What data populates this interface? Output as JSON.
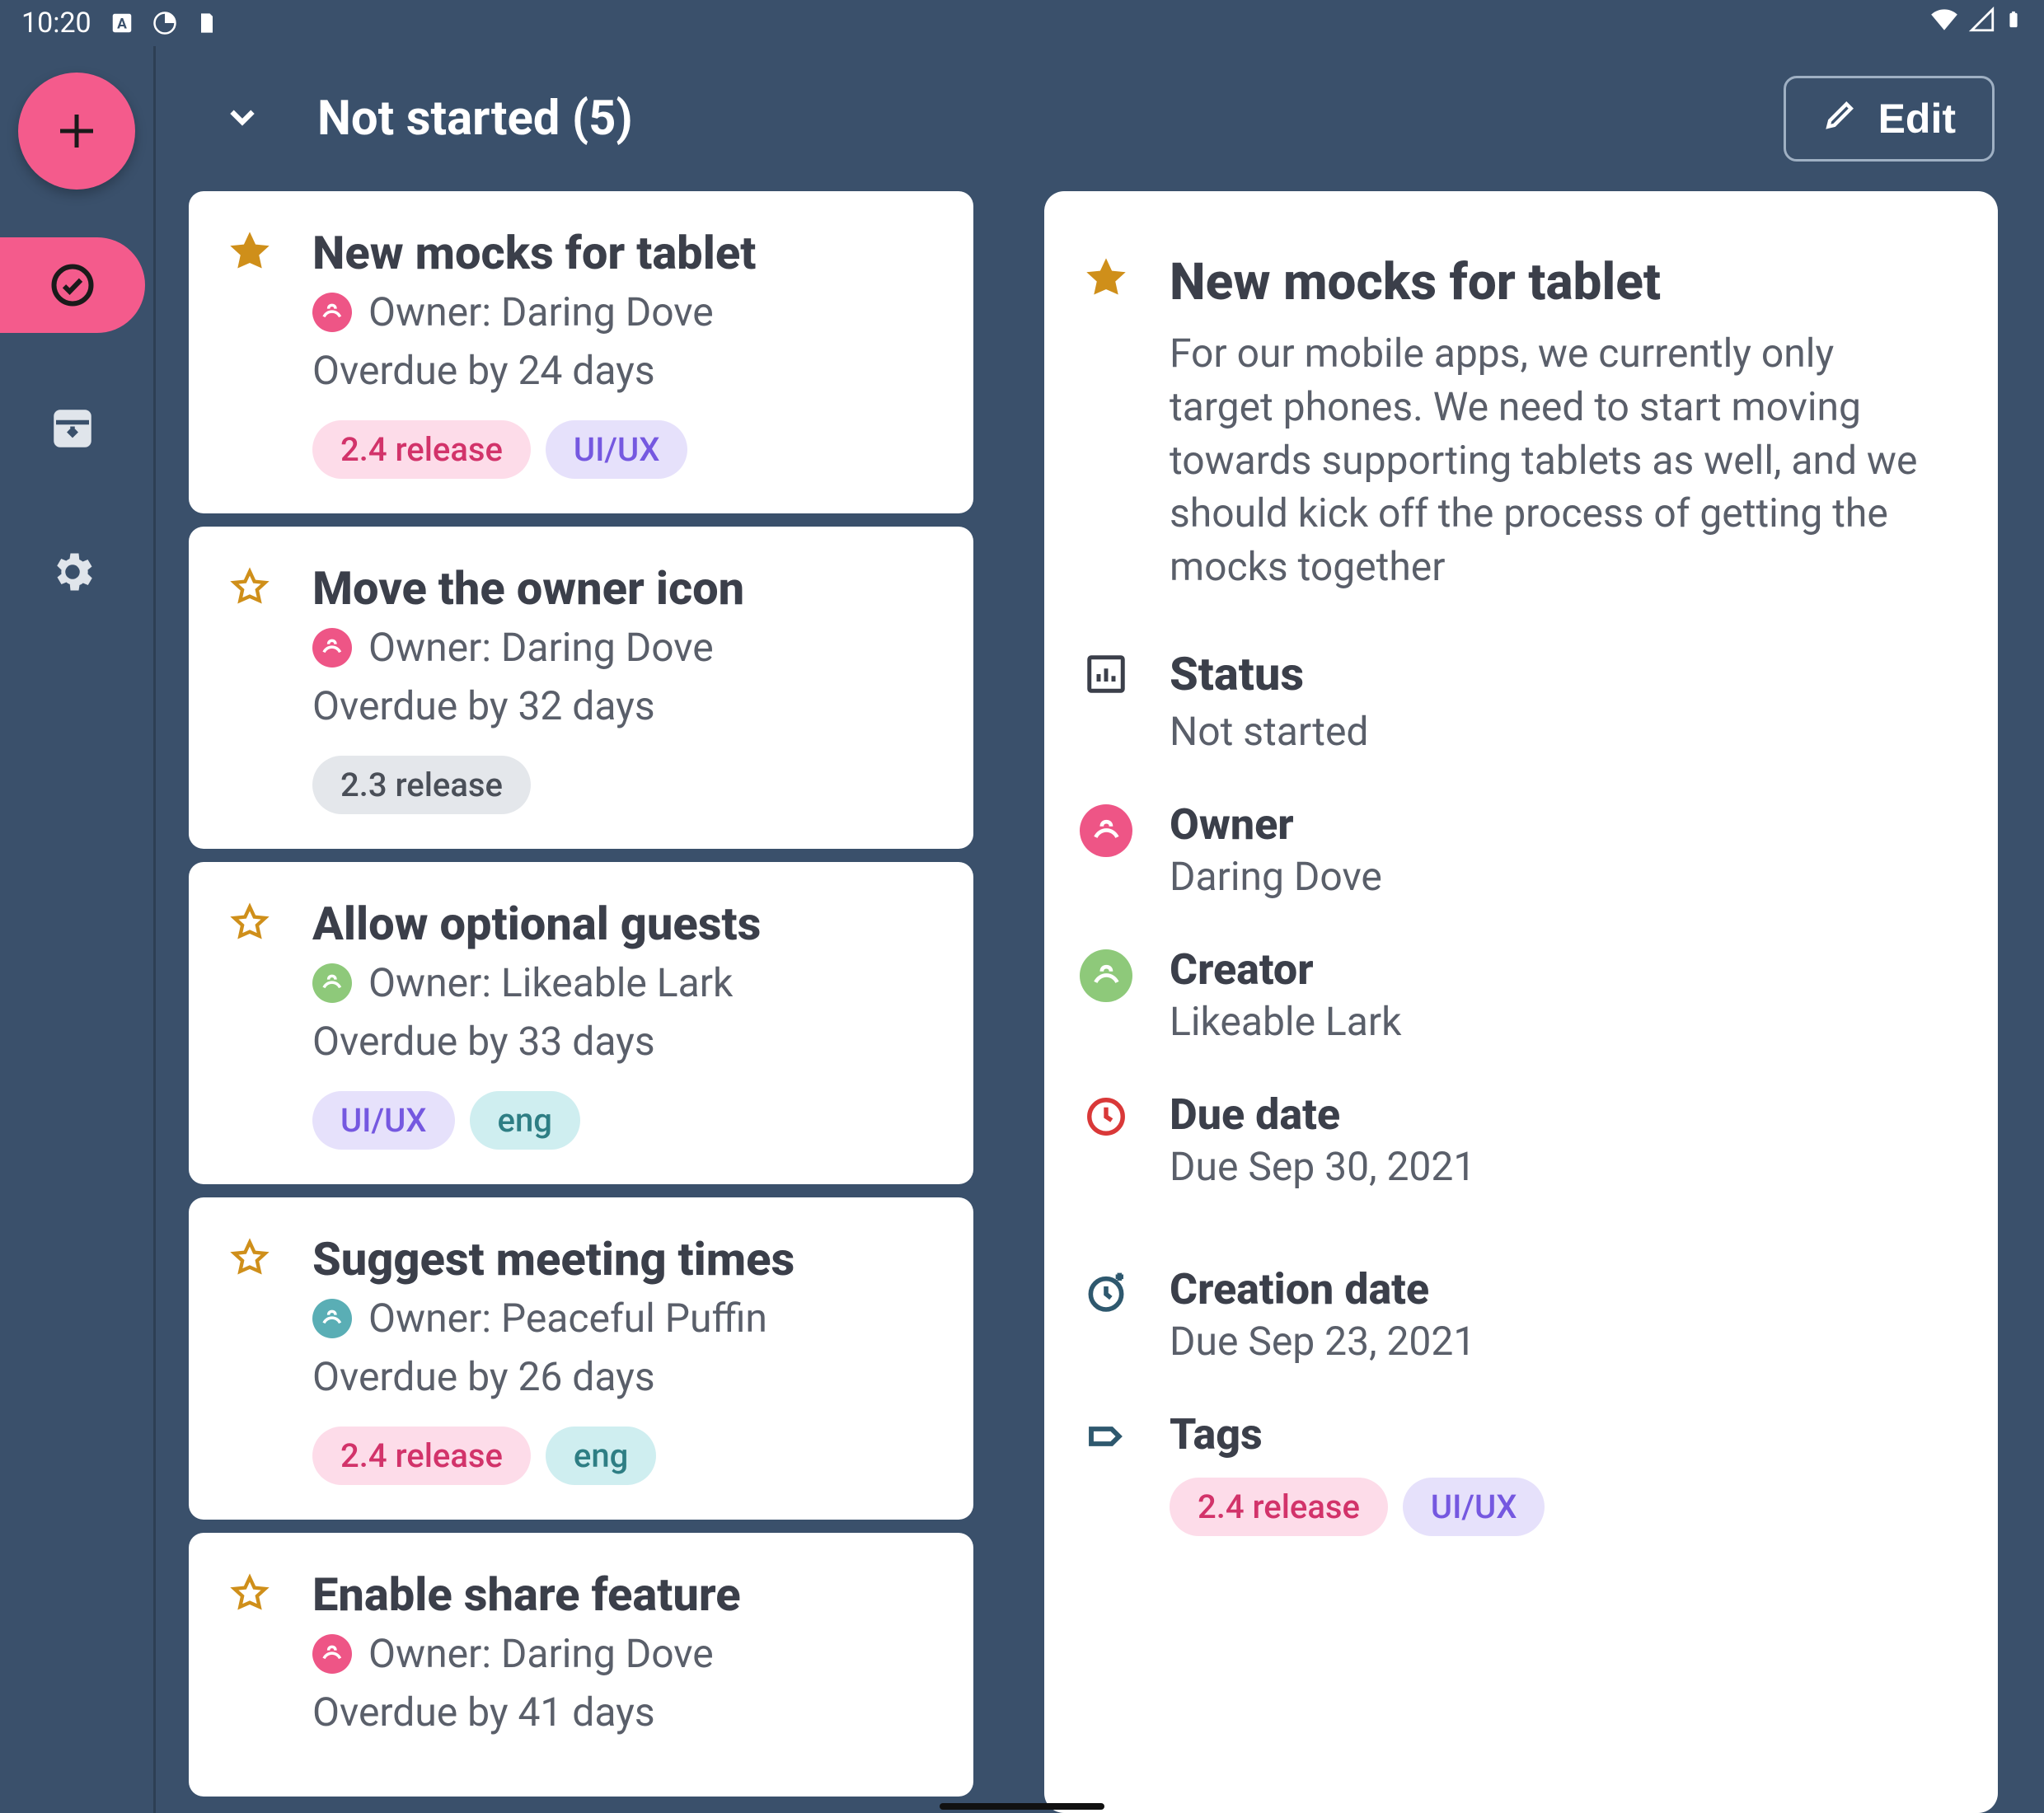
{
  "statusbar": {
    "time": "10:20"
  },
  "rail": {
    "fab_label": "+"
  },
  "header": {
    "title": "Not started (5)",
    "edit_label": "Edit"
  },
  "avatar_colors": {
    "dove": "#ee5586",
    "lark": "#8ec97a",
    "puffin": "#5aaeb5"
  },
  "tag_colors": {
    "release24": {
      "bg": "#fddce9",
      "fg": "#d2336a"
    },
    "uiux": {
      "bg": "#e6e1fb",
      "fg": "#7558e0"
    },
    "release23": {
      "bg": "#e4e7eb",
      "fg": "#4a4f58"
    },
    "eng": {
      "bg": "#cfeef0",
      "fg": "#2e7e84"
    }
  },
  "tasks": [
    {
      "starred": true,
      "title": "New mocks for tablet",
      "owner": "Owner: Daring Dove",
      "owner_avatar": "dove",
      "due": "Overdue by 24 days",
      "tags": [
        {
          "label": "2.4 release",
          "style": "release24"
        },
        {
          "label": "UI/UX",
          "style": "uiux"
        }
      ]
    },
    {
      "starred": false,
      "title": "Move the owner icon",
      "owner": "Owner: Daring Dove",
      "owner_avatar": "dove",
      "due": "Overdue by 32 days",
      "tags": [
        {
          "label": "2.3 release",
          "style": "release23"
        }
      ]
    },
    {
      "starred": false,
      "title": "Allow optional guests",
      "owner": "Owner: Likeable Lark",
      "owner_avatar": "lark",
      "due": "Overdue by 33 days",
      "tags": [
        {
          "label": "UI/UX",
          "style": "uiux"
        },
        {
          "label": "eng",
          "style": "eng"
        }
      ]
    },
    {
      "starred": false,
      "title": "Suggest meeting times",
      "owner": "Owner: Peaceful Puffin",
      "owner_avatar": "puffin",
      "due": "Overdue by 26 days",
      "tags": [
        {
          "label": "2.4 release",
          "style": "release24"
        },
        {
          "label": "eng",
          "style": "eng"
        }
      ]
    },
    {
      "starred": false,
      "title": "Enable share feature",
      "owner": "Owner: Daring Dove",
      "owner_avatar": "dove",
      "due": "Overdue by 41 days",
      "tags": []
    }
  ],
  "detail": {
    "starred": true,
    "title": "New mocks for tablet",
    "description": "For our mobile apps, we currently only target phones. We need to start moving towards supporting tablets as well, and we should kick off the process of getting the mocks together",
    "status_label": "Status",
    "status_value": "Not started",
    "owner_label": "Owner",
    "owner_value": "Daring Dove",
    "owner_avatar": "dove",
    "creator_label": "Creator",
    "creator_value": "Likeable Lark",
    "creator_avatar": "lark",
    "due_label": "Due date",
    "due_value": "Due Sep 30, 2021",
    "created_label": "Creation date",
    "created_value": "Due Sep 23, 2021",
    "tags_label": "Tags",
    "tags": [
      {
        "label": "2.4 release",
        "style": "release24"
      },
      {
        "label": "UI/UX",
        "style": "uiux"
      }
    ]
  }
}
